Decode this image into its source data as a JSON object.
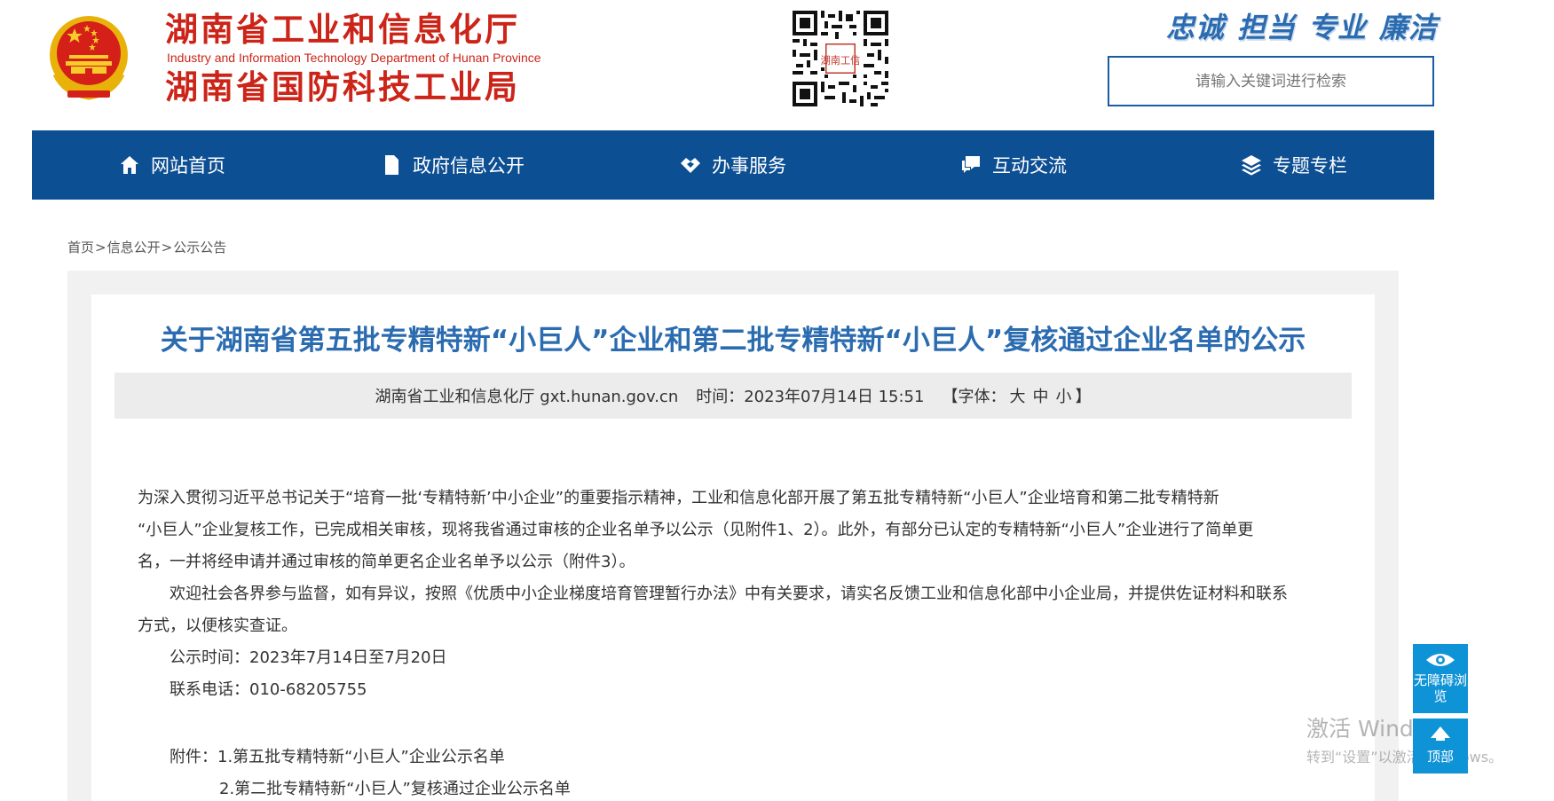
{
  "header": {
    "org_name_1": "湖南省工业和信息化厅",
    "org_name_en": "Industry and Information Technology Department of Hunan Province",
    "org_name_2": "湖南省国防科技工业局",
    "qr_label": "湖南工信",
    "slogans": [
      "忠诚",
      "担当",
      "专业",
      "廉洁"
    ],
    "search_placeholder": "请输入关键词进行检索"
  },
  "nav": [
    {
      "label": "网站首页",
      "icon": "home-icon"
    },
    {
      "label": "政府信息公开",
      "icon": "document-icon"
    },
    {
      "label": "办事服务",
      "icon": "handshake-icon"
    },
    {
      "label": "互动交流",
      "icon": "chat-icon"
    },
    {
      "label": "专题专栏",
      "icon": "layers-icon"
    }
  ],
  "breadcrumb": [
    "首页",
    "信息公开",
    "公示公告"
  ],
  "breadcrumb_sep": ">",
  "article": {
    "title": "关于湖南省第五批专精特新“小巨人”企业和第二批专精特新“小巨人”复核通过企业名单的公示",
    "source": "湖南省工业和信息化厅 gxt.hunan.gov.cn",
    "time_label": "时间：",
    "time": "2023年07月14日 15:51",
    "font_label": "【字体：",
    "font_large": "大",
    "font_medium": "中",
    "font_small": "小",
    "font_close": "】",
    "para1_line1": "为深入贯彻习近平总书记关于“培育一批‘专精特新’中小企业”的重要指示精神，工业和信息化部开展了第五批专精特新“小巨人”企业培育和第二批专精特新",
    "para1_line2": "“小巨人”企业复核工作，已完成相关审核，现将我省通过审核的企业名单予以公示（见附件1、2）。此外，有部分已认定的专精特新“小巨人”企业进行了简单更",
    "para1_line3": "名，一并将经申请并通过审核的简单更名企业名单予以公示（附件3）。",
    "para2_line1": "欢迎社会各界参与监督，如有异议，按照《优质中小企业梯度培育管理暂行办法》中有关要求，请实名反馈工业和信息化部中小企业局，并提供佐证材料和联系",
    "para2_line2": "方式，以便核实查证。",
    "period": "公示时间：2023年7月14日至7月20日",
    "phone": "联系电话：010-68205755",
    "attach_label": "附件：",
    "attach_1": "1.第五批专精特新“小巨人”企业公示名单",
    "attach_2": "2.第二批专精特新“小巨人”复核通过企业公示名单"
  },
  "float": {
    "access": "无障碍浏览",
    "top": "顶部"
  },
  "watermark": {
    "line1": "激活 Windows",
    "line2": "转到“设置”以激活 Windows。"
  },
  "colors": {
    "brand_red": "#cc2418",
    "nav_blue": "#0d4f93",
    "title_blue": "#2b6cb0",
    "float_blue": "#0f93d7"
  }
}
